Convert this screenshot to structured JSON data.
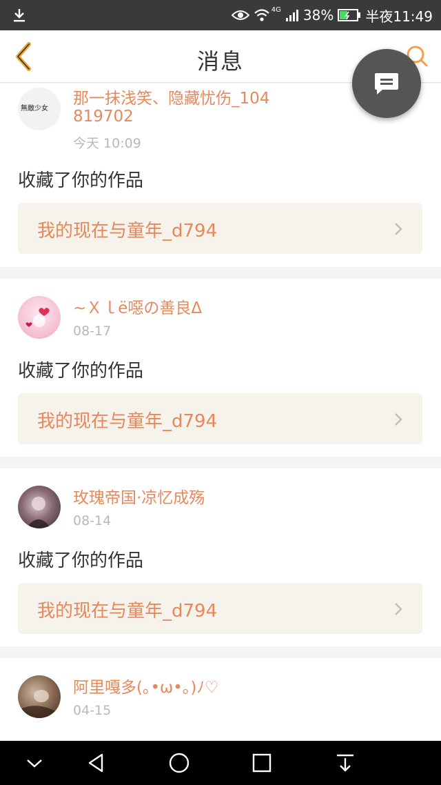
{
  "status_bar": {
    "network": "4G",
    "battery": "38%",
    "time": "半夜11:49"
  },
  "header": {
    "title": "消息"
  },
  "icons": {
    "back": "chevron-left-icon",
    "search": "search-icon",
    "chat": "chat-bubble-icon",
    "arrow": "chevron-right-icon"
  },
  "colors": {
    "accent": "#e8885a",
    "status_bar": "#3a3a3a",
    "fab": "#555555",
    "work_bg": "#f5f3ec"
  },
  "messages": [
    {
      "username": "那一抹浅笑、隐藏忧伤_104819702",
      "time": "今天 10:09",
      "action": "收藏了你的作品",
      "work_title": "我的现在与童年_d794",
      "avatar_text": "無敵少女"
    },
    {
      "username": "~Ｘｌё噁の善良Δ",
      "time": "08-17",
      "action": "收藏了你的作品",
      "work_title": "我的现在与童年_d794"
    },
    {
      "username": "玫瑰帝国·凉忆成殇",
      "time": "08-14",
      "action": "收藏了你的作品",
      "work_title": "我的现在与童年_d794"
    },
    {
      "username": "阿里嘎多(｡•ω•｡)ﾉ♡",
      "time": "04-15"
    }
  ]
}
